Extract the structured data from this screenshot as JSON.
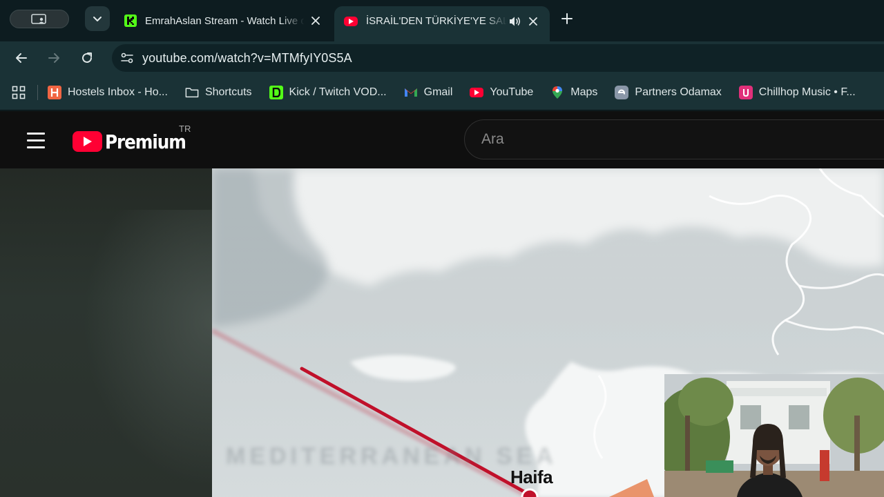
{
  "browser": {
    "tabs": [
      {
        "title": "EmrahAslan Stream - Watch Live on Kick",
        "favicon": "kick-icon",
        "active": false
      },
      {
        "title": "İSRAİL'DEN TÜRKİYE'YE SALDIRI",
        "favicon": "youtube-icon",
        "active": true,
        "audio": "speaker-icon"
      }
    ],
    "url": "youtube.com/watch?v=MTMfyIY0S5A",
    "bookmarks": [
      {
        "label": "Hostels Inbox - Ho...",
        "icon": "hostelworld-icon",
        "color": "#f06543"
      },
      {
        "label": "Shortcuts",
        "icon": "folder-icon"
      },
      {
        "label": "Kick / Twitch VOD...",
        "icon": "kick-d-icon",
        "color": "#53fc18"
      },
      {
        "label": "Gmail",
        "icon": "gmail-icon"
      },
      {
        "label": "YouTube",
        "icon": "youtube-icon",
        "color": "#ff0033"
      },
      {
        "label": "Maps",
        "icon": "maps-pin-icon"
      },
      {
        "label": "Partners Odamax",
        "icon": "odamax-icon"
      },
      {
        "label": "Chillhop Music • F...",
        "icon": "chillhop-icon",
        "color": "#e0307a"
      }
    ]
  },
  "youtube": {
    "logo_text": "Premium",
    "country_code": "TR",
    "search_placeholder": "Ara"
  },
  "video": {
    "map_label": "Haifa",
    "sea_label": "MEDITERRANEAN SEA"
  },
  "colors": {
    "accent_red": "#ff0033",
    "route_line": "#c0102a",
    "chrome_bg": "#1a3236"
  }
}
